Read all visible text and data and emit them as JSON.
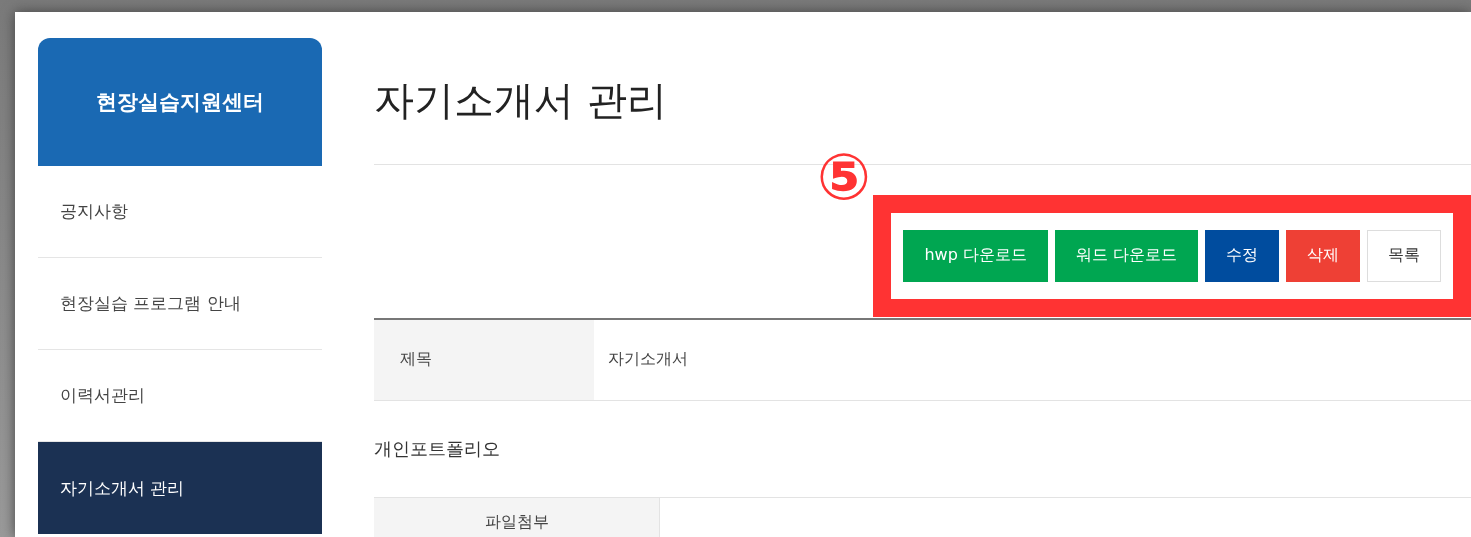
{
  "sidebar": {
    "title": "현장실습지원센터",
    "items": [
      {
        "label": "공지사항",
        "selected": false
      },
      {
        "label": "현장실습 프로그램 안내",
        "selected": false
      },
      {
        "label": "이력서관리",
        "selected": false
      },
      {
        "label": "자기소개서 관리",
        "selected": true
      }
    ]
  },
  "page_title": "자기소개서 관리",
  "annotation": {
    "badge": "⑤"
  },
  "buttons": [
    {
      "label": "hwp 다운로드",
      "kind": "download"
    },
    {
      "label": "워드 다운로드",
      "kind": "download"
    },
    {
      "label": "수정",
      "kind": "edit"
    },
    {
      "label": "삭제",
      "kind": "delete"
    },
    {
      "label": "목록",
      "kind": "list"
    }
  ],
  "detail": {
    "label": "제목",
    "value": "자기소개서"
  },
  "section_title": "개인포트폴리오",
  "attachment": {
    "label": "파일첨부"
  }
}
